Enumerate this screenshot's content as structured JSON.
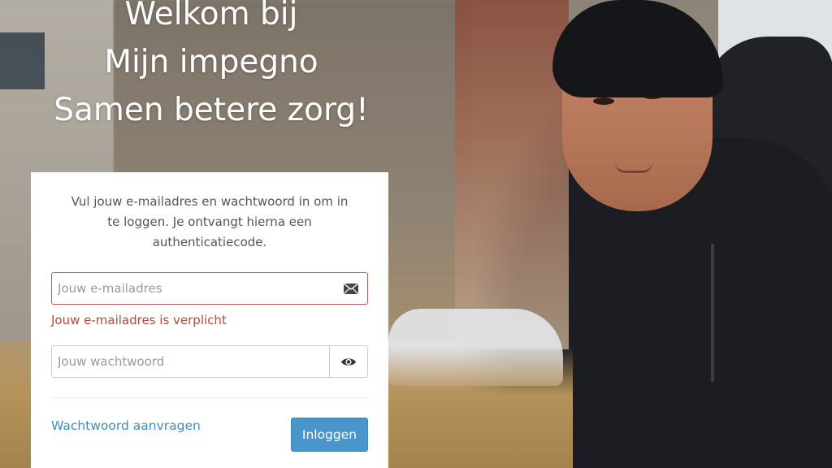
{
  "headline": {
    "line1": "Welkom bij",
    "line2": "Mijn impegno",
    "line3": "Samen betere zorg!"
  },
  "login": {
    "intro": "Vul jouw e-mailadres en wachtwoord in om in te loggen. Je ontvangt hierna een authenticatiecode.",
    "email_placeholder": "Jouw e-mailadres",
    "email_value": "",
    "email_error": "Jouw e-mailadres is verplicht",
    "password_placeholder": "Jouw wachtwoord",
    "password_value": "",
    "forgot_link": "Wachtwoord aanvragen",
    "submit_label": "Inloggen"
  },
  "icons": {
    "email": "envelope-icon",
    "password_toggle": "eye-icon"
  },
  "colors": {
    "link": "#3d8cc0",
    "button": "#4a95c9",
    "error": "#b24a3e",
    "error_border": "#c45a57"
  }
}
